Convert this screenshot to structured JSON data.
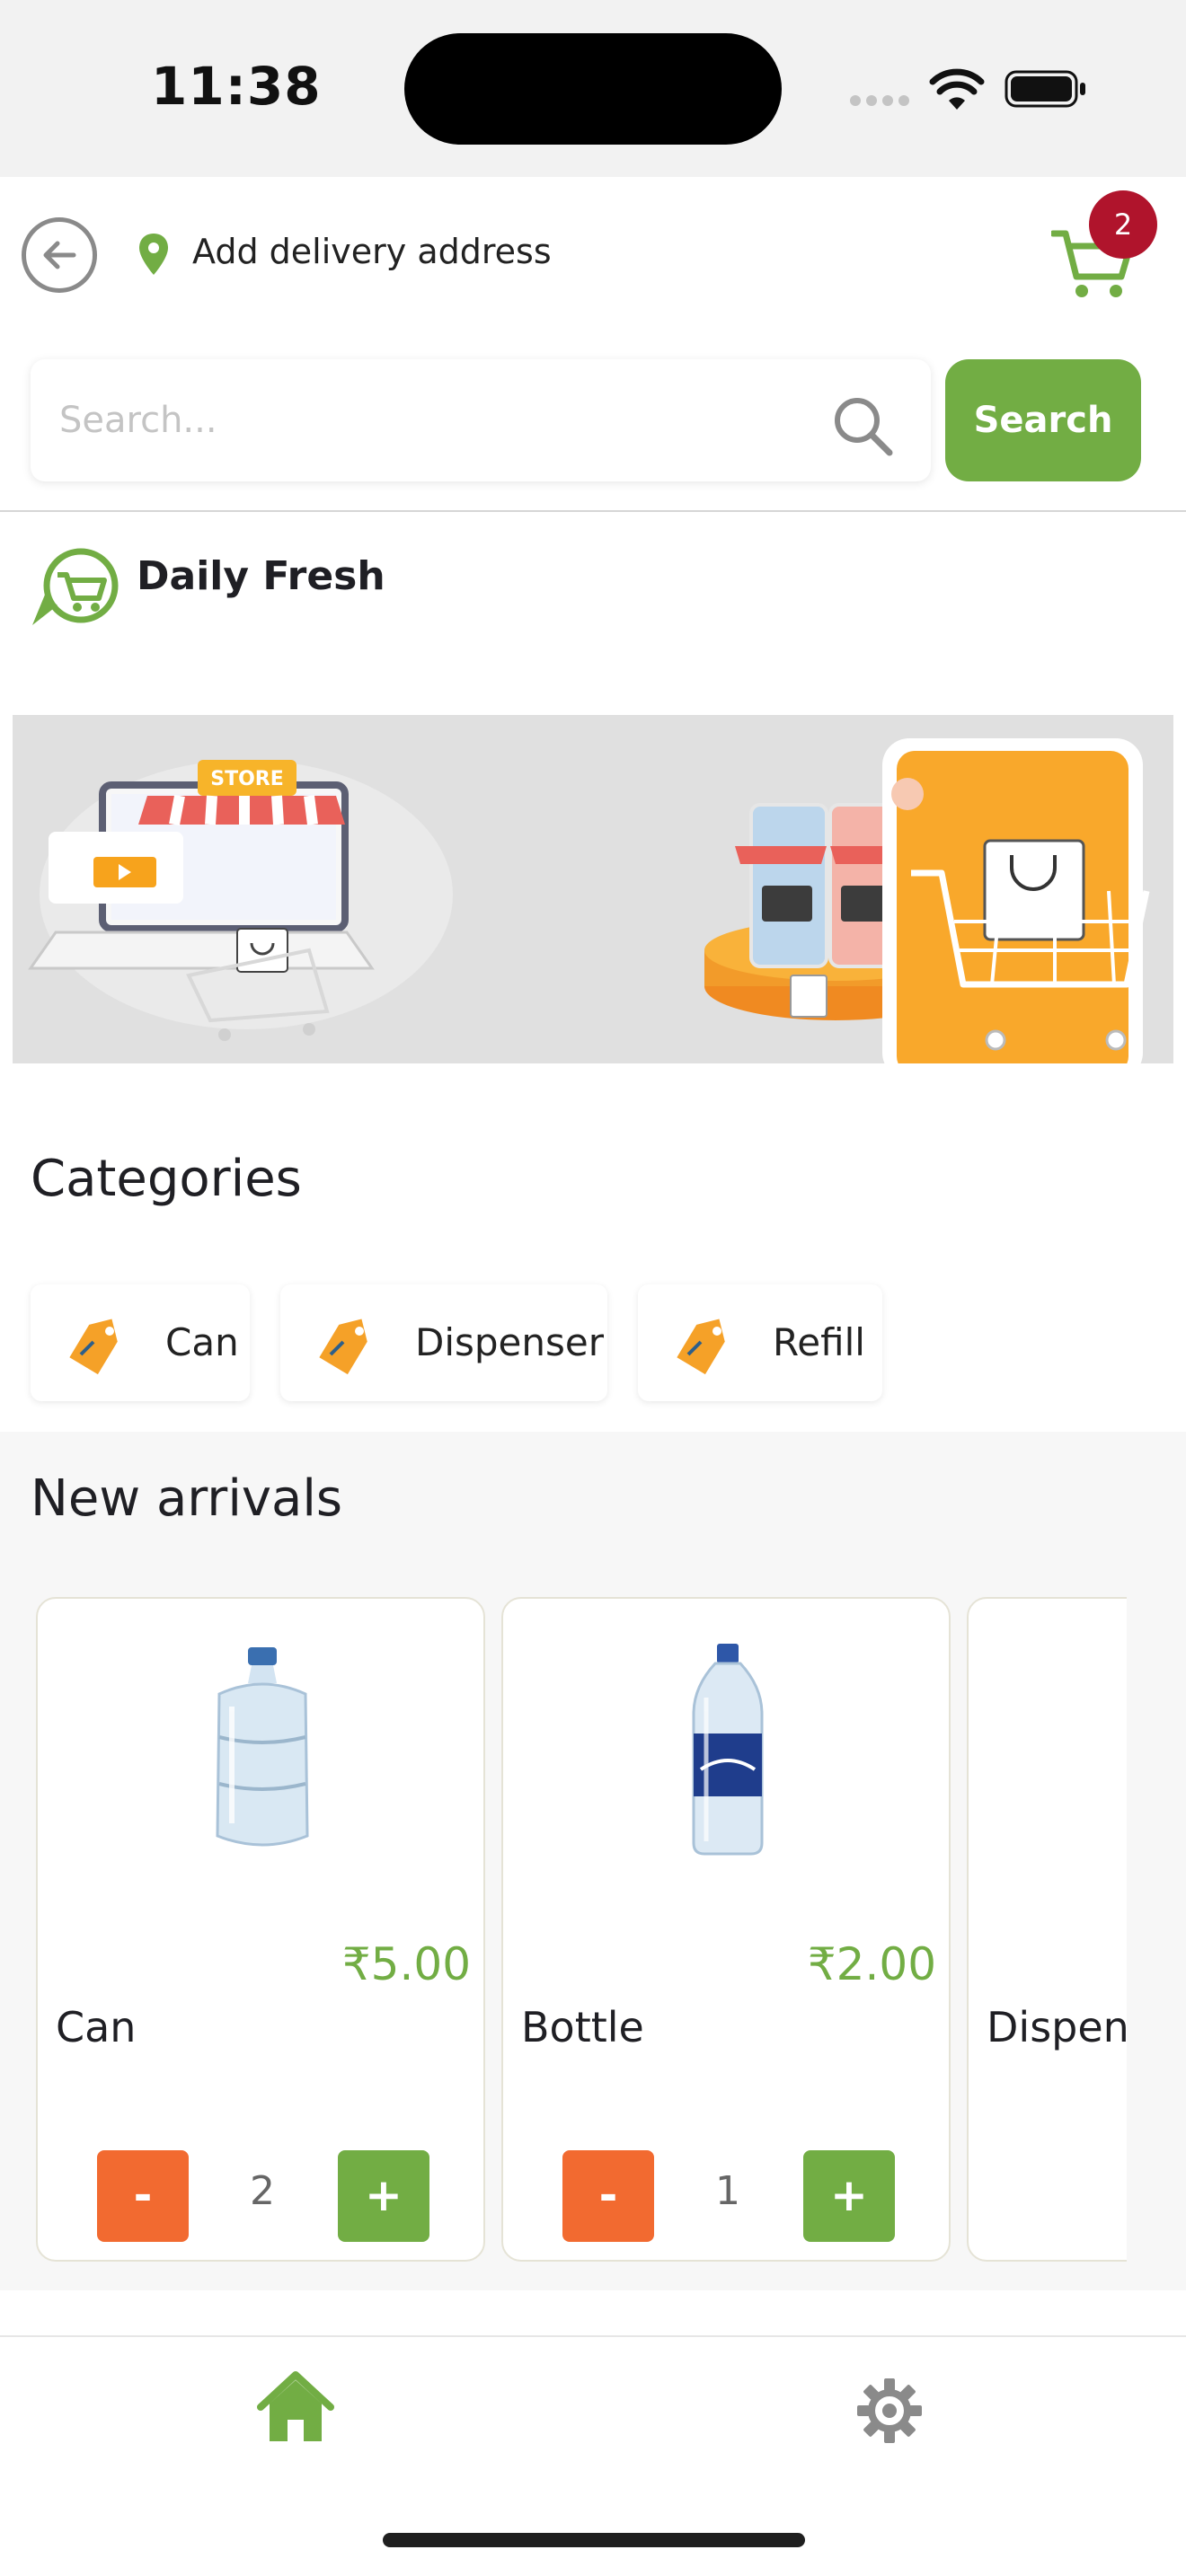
{
  "status_bar": {
    "time": "11:38"
  },
  "header": {
    "address": "Add delivery address",
    "cart_count": "2"
  },
  "search": {
    "placeholder": "Search...",
    "button_label": "Search"
  },
  "brand": {
    "name": "Daily Fresh"
  },
  "categories": {
    "title": "Categories",
    "items": [
      {
        "label": "Can"
      },
      {
        "label": "Dispenser"
      },
      {
        "label": "Refill"
      }
    ]
  },
  "new_arrivals": {
    "title": "New arrivals",
    "products": [
      {
        "name": "Can",
        "price": "₹5.00",
        "quantity": "2"
      },
      {
        "name": "Bottle",
        "price": "₹2.00",
        "quantity": "1"
      },
      {
        "name": "Dispens"
      }
    ],
    "minus_label": "-",
    "plus_label": "+"
  },
  "banner": {
    "store_sign": "STORE"
  },
  "colors": {
    "accent": "#72ad44",
    "minus": "#f26a30",
    "badge": "#b0142c"
  },
  "icons": [
    "back-arrow-icon",
    "location-pin-icon",
    "cart-icon",
    "search-icon",
    "shopping-cart-logo-icon",
    "tag-icon",
    "home-icon",
    "gear-icon"
  ]
}
